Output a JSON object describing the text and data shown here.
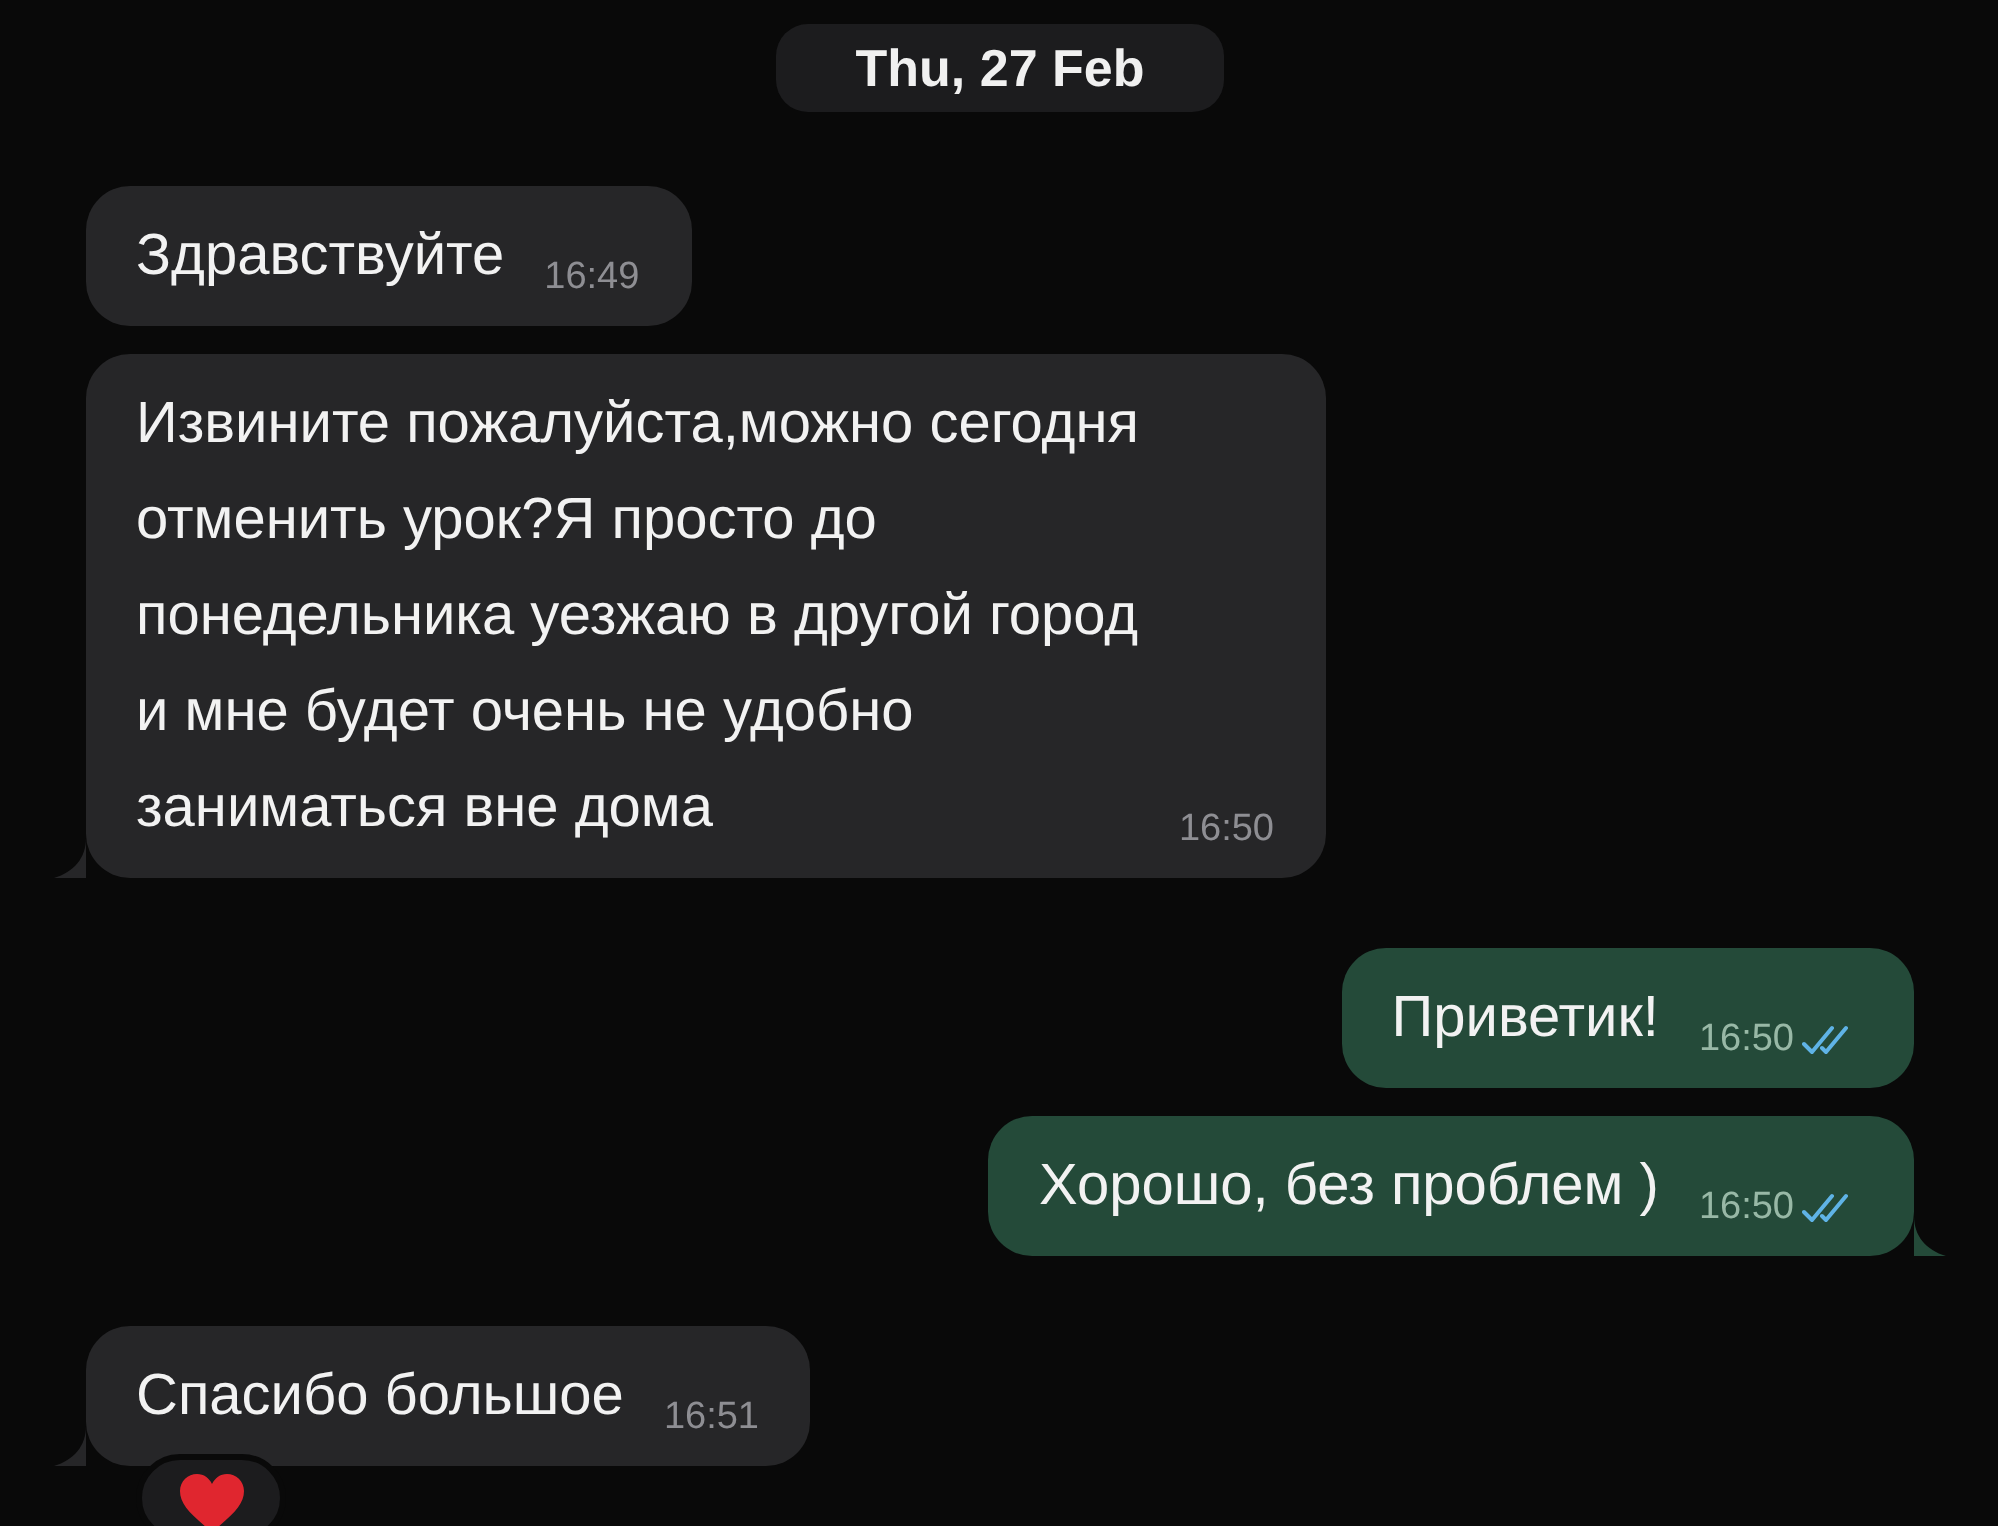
{
  "date_badge": "Thu, 27 Feb",
  "messages": [
    {
      "kind": "incoming",
      "text": "Здравствуйте",
      "time": "16:49",
      "tail": false,
      "reacted": false
    },
    {
      "kind": "incoming",
      "text": "Извините пожалуйста,можно сегодня\nотменить урок?Я просто до\nпонедельника уезжаю в другой город\nи мне будет очень не удобно\nзаниматься вне дома",
      "time": "16:50",
      "tail": true,
      "reacted": false
    },
    {
      "kind": "outgoing",
      "text": "Приветик!",
      "time": "16:50",
      "read": true,
      "tail": false,
      "reacted": false
    },
    {
      "kind": "outgoing",
      "text": "Хорошо, без проблем )",
      "time": "16:50",
      "read": true,
      "tail": true,
      "reacted": false
    },
    {
      "kind": "incoming",
      "text": "Спасибо большое",
      "time": "16:51",
      "tail": true,
      "reacted": true
    }
  ]
}
